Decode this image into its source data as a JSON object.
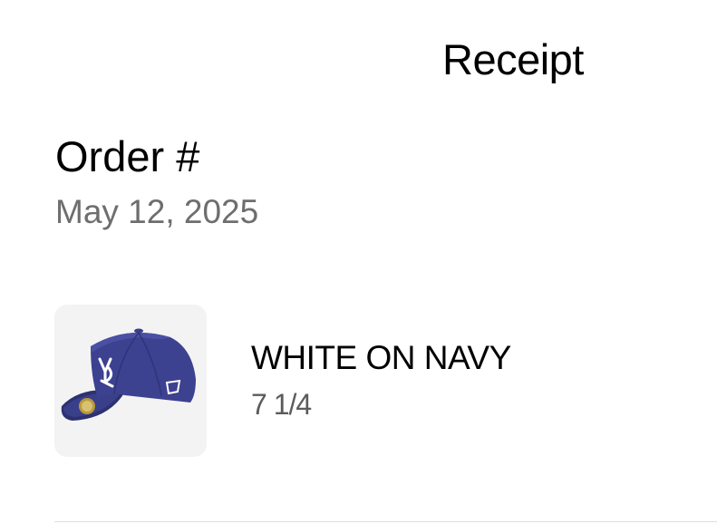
{
  "header": {
    "title": "Receipt"
  },
  "order": {
    "title": "Order #",
    "date": "May 12, 2025"
  },
  "item": {
    "image_icon": "navy-fitted-cap-image",
    "name": "WHITE ON NAVY",
    "size": "7 1/4"
  },
  "colors": {
    "text_primary": "#000000",
    "text_secondary": "#6e6e6e",
    "thumb_background": "#f3f3f3",
    "cap_navy": "#3a3f8a"
  }
}
